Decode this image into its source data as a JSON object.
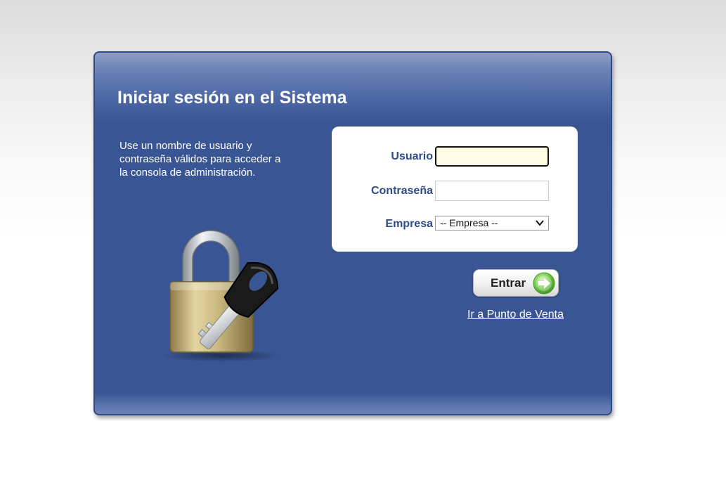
{
  "login": {
    "title": "Iniciar sesión en el Sistema",
    "description": "Use un nombre de usuario y contraseña válidos para acceder a la consola de administración.",
    "fields": {
      "user_label": "Usuario",
      "user_value": "",
      "password_label": "Contraseña",
      "password_value": "",
      "company_label": "Empresa",
      "company_selected": "-- Empresa --"
    },
    "enter_button": "Entrar",
    "pos_link": "Ir a Punto de Venta"
  },
  "icons": {
    "illustration": "padlock-with-key-icon",
    "enter": "green-arrow-right-icon",
    "dropdown": "chevron-down-icon"
  },
  "colors": {
    "panel_background": "#3a5593",
    "label_color": "#2e4b85",
    "user_field_background": "#fffce6",
    "enter_icon_green": "#6cc644"
  }
}
